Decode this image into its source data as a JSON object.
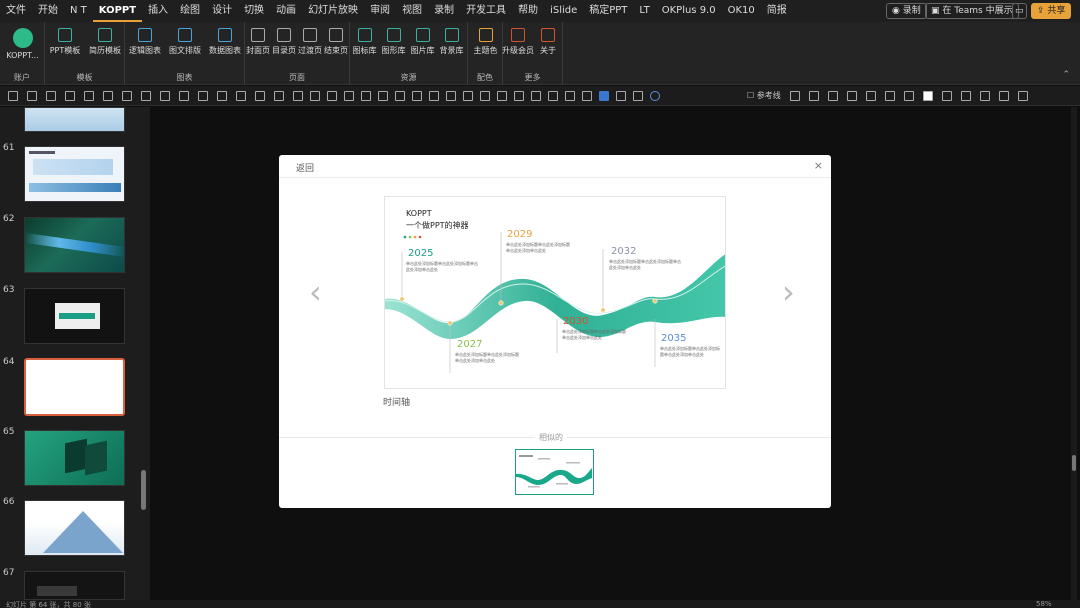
{
  "menubar": {
    "items": [
      "文件",
      "开始",
      "N T",
      "KOPPT",
      "插入",
      "绘图",
      "设计",
      "切换",
      "动画",
      "幻灯片放映",
      "审阅",
      "视图",
      "录制",
      "开发工具",
      "帮助",
      "iSlide",
      "稿定PPT",
      "LT",
      "OKPlus 9.0",
      "OK10",
      "简报"
    ],
    "active": "KOPPT",
    "record_label": "录制",
    "teams_label": "在 Teams 中展示",
    "share_label": "共享"
  },
  "ribbon": {
    "groups": [
      {
        "label": "账户",
        "buttons": [
          "KOPPT..."
        ]
      },
      {
        "label": "模板",
        "buttons": [
          "PPT模板",
          "简历模板"
        ]
      },
      {
        "label": "图表",
        "buttons": [
          "逻辑图表",
          "图文排版",
          "数据图表"
        ]
      },
      {
        "label": "页面",
        "buttons": [
          "封面页",
          "目录页",
          "过渡页",
          "结束页"
        ]
      },
      {
        "label": "资源",
        "buttons": [
          "图标库",
          "图形库",
          "图片库",
          "背景库"
        ]
      },
      {
        "label": "配色",
        "buttons": [
          "主题色"
        ]
      },
      {
        "label": "更多",
        "buttons": [
          "升级会员",
          "关于"
        ]
      }
    ]
  },
  "qat": {
    "ref_label": "参考线"
  },
  "slides": {
    "numbers": [
      "61",
      "62",
      "63",
      "64",
      "65",
      "66",
      "67"
    ]
  },
  "dialog": {
    "title": "返回",
    "close": "×",
    "prev": "‹",
    "next": "›",
    "caption": "时间轴",
    "similar_label": "相似的",
    "preview": {
      "brand": "KOPPT",
      "tagline": "一个做PPT的神器",
      "years": [
        "2025",
        "2027",
        "2029",
        "2030",
        "2032",
        "2035"
      ],
      "year_colors": [
        "#1a9e86",
        "#8dbf4a",
        "#e8a23a",
        "#d0542e",
        "#8b94a8",
        "#5b8fd8"
      ],
      "body_text": "单击此处添加标题单击此处添加标题单击此处添加单击此处"
    }
  },
  "statusbar": {
    "left": "幻灯片 第 64 张，共 80 张",
    "right": "58%"
  }
}
